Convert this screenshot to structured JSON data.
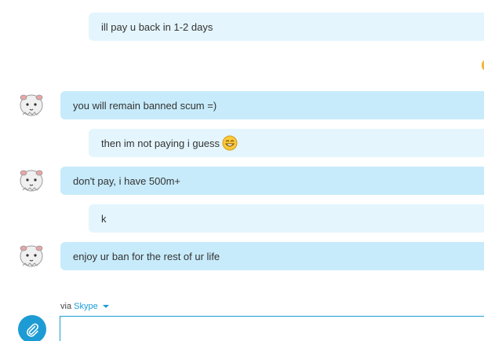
{
  "messages": [
    {
      "text": "ill pay u back in 1-2 days"
    },
    {
      "text": "you will remain banned scum =)"
    },
    {
      "text": "then im not paying i guess"
    },
    {
      "text": "don't pay, i have 500m+"
    },
    {
      "text": "k"
    },
    {
      "text": "enjoy ur ban for the rest of ur life"
    }
  ],
  "footer": {
    "via_label": "via",
    "service_name": "Skype"
  },
  "compose": {
    "value": ""
  },
  "colors": {
    "outgoing_bubble": "#e4f5fd",
    "incoming_bubble": "#c7ebfb",
    "accent": "#1d9bd4"
  },
  "icons": {
    "avatar": "sheep-avatar-icon",
    "emoticon": "smile-emoticon-icon",
    "attach": "paperclip-icon",
    "dropdown": "caret-down-icon"
  }
}
